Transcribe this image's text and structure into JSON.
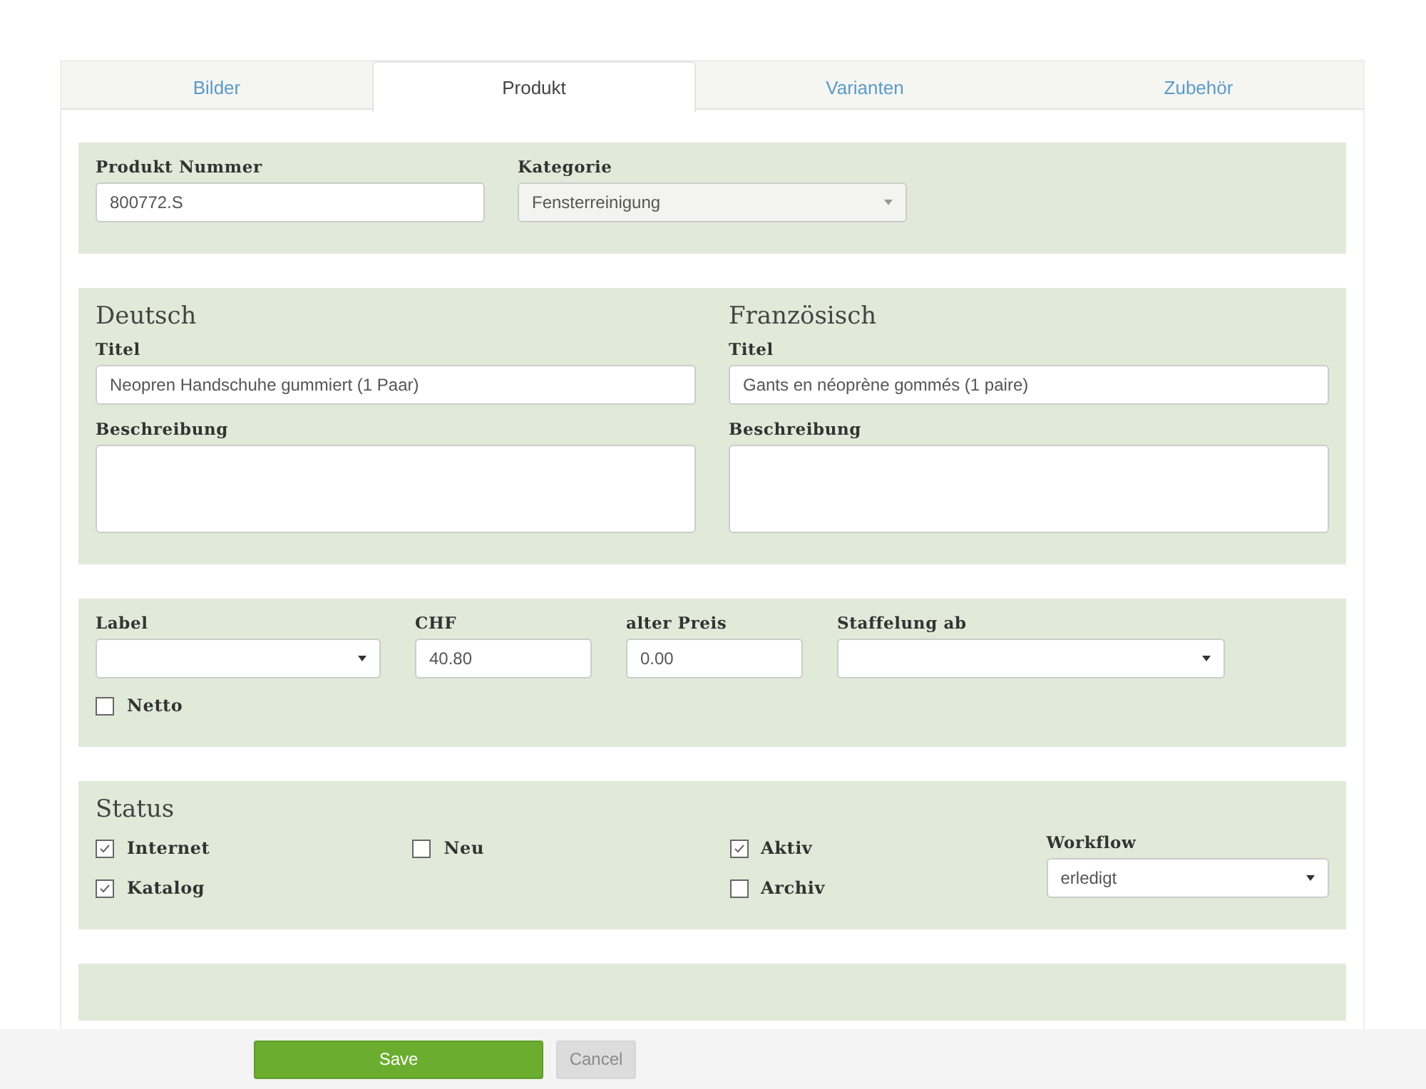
{
  "tabs": [
    {
      "label": "Bilder",
      "selected": false
    },
    {
      "label": "Produkt",
      "selected": true
    },
    {
      "label": "Varianten",
      "selected": false
    },
    {
      "label": "Zubehör",
      "selected": false
    }
  ],
  "product": {
    "number_label": "Produkt Nummer",
    "number_value": "800772.S",
    "category_label": "Kategorie",
    "category_value": "Fensterreinigung"
  },
  "languages": [
    {
      "heading": "Deutsch",
      "title_label": "Titel",
      "title_value": "Neopren Handschuhe gummiert (1 Paar)",
      "description_label": "Beschreibung"
    },
    {
      "heading": "Französisch",
      "title_label": "Titel",
      "title_value": "Gants en néoprène gommés (1 paire)",
      "description_label": "Beschreibung"
    }
  ],
  "pricing": {
    "fields": [
      {
        "label": "Label",
        "kind": "select"
      },
      {
        "label": "CHF",
        "kind": "input",
        "value": "40.80"
      },
      {
        "label": "alter Preis",
        "kind": "input",
        "value": "0.00"
      },
      {
        "label": "Staffelung ab",
        "kind": "select"
      }
    ],
    "netto": {
      "label": "Netto",
      "checked": false
    }
  },
  "status": {
    "heading": "Status",
    "columns": [
      [
        {
          "label": "Internet",
          "checked": true
        },
        {
          "label": "Katalog",
          "checked": true
        }
      ],
      [
        {
          "label": "Neu",
          "checked": false
        }
      ],
      [
        {
          "label": "Aktiv",
          "checked": true
        },
        {
          "label": "Archiv",
          "checked": false
        }
      ]
    ],
    "workflow_label": "Workflow",
    "workflow_value": "erledigt"
  },
  "buttons": [
    {
      "label": "Save",
      "disabled": false
    },
    {
      "label": "Cancel",
      "disabled": true
    }
  ]
}
